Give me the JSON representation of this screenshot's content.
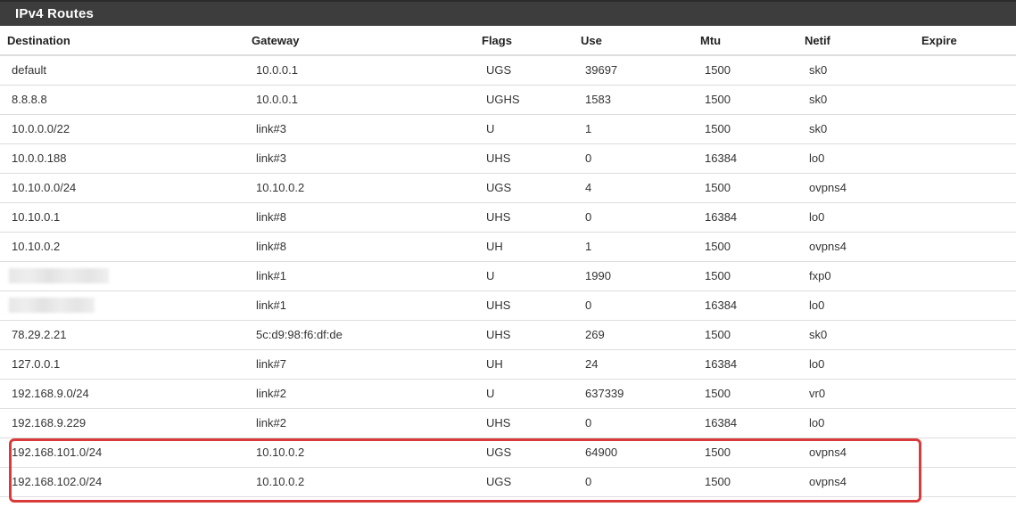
{
  "panel": {
    "title": "IPv4 Routes"
  },
  "table": {
    "headers": {
      "destination": "Destination",
      "gateway": "Gateway",
      "flags": "Flags",
      "use": "Use",
      "mtu": "Mtu",
      "netif": "Netif",
      "expire": "Expire"
    },
    "rows": [
      {
        "destination": "default",
        "gateway": "10.0.0.1",
        "flags": "UGS",
        "use": "39697",
        "mtu": "1500",
        "netif": "sk0",
        "expire": ""
      },
      {
        "destination": "8.8.8.8",
        "gateway": "10.0.0.1",
        "flags": "UGHS",
        "use": "1583",
        "mtu": "1500",
        "netif": "sk0",
        "expire": ""
      },
      {
        "destination": "10.0.0.0/22",
        "gateway": "link#3",
        "flags": "U",
        "use": "1",
        "mtu": "1500",
        "netif": "sk0",
        "expire": ""
      },
      {
        "destination": "10.0.0.188",
        "gateway": "link#3",
        "flags": "UHS",
        "use": "0",
        "mtu": "16384",
        "netif": "lo0",
        "expire": ""
      },
      {
        "destination": "10.10.0.0/24",
        "gateway": "10.10.0.2",
        "flags": "UGS",
        "use": "4",
        "mtu": "1500",
        "netif": "ovpns4",
        "expire": ""
      },
      {
        "destination": "10.10.0.1",
        "gateway": "link#8",
        "flags": "UHS",
        "use": "0",
        "mtu": "16384",
        "netif": "lo0",
        "expire": ""
      },
      {
        "destination": "10.10.0.2",
        "gateway": "link#8",
        "flags": "UH",
        "use": "1",
        "mtu": "1500",
        "netif": "ovpns4",
        "expire": ""
      },
      {
        "destination": "",
        "gateway": "link#1",
        "flags": "U",
        "use": "1990",
        "mtu": "1500",
        "netif": "fxp0",
        "expire": ""
      },
      {
        "destination": "",
        "gateway": "link#1",
        "flags": "UHS",
        "use": "0",
        "mtu": "16384",
        "netif": "lo0",
        "expire": ""
      },
      {
        "destination": "78.29.2.21",
        "gateway": "5c:d9:98:f6:df:de",
        "flags": "UHS",
        "use": "269",
        "mtu": "1500",
        "netif": "sk0",
        "expire": ""
      },
      {
        "destination": "127.0.0.1",
        "gateway": "link#7",
        "flags": "UH",
        "use": "24",
        "mtu": "16384",
        "netif": "lo0",
        "expire": ""
      },
      {
        "destination": "192.168.9.0/24",
        "gateway": "link#2",
        "flags": "U",
        "use": "637339",
        "mtu": "1500",
        "netif": "vr0",
        "expire": ""
      },
      {
        "destination": "192.168.9.229",
        "gateway": "link#2",
        "flags": "UHS",
        "use": "0",
        "mtu": "16384",
        "netif": "lo0",
        "expire": ""
      },
      {
        "destination": "192.168.101.0/24",
        "gateway": "10.10.0.2",
        "flags": "UGS",
        "use": "64900",
        "mtu": "1500",
        "netif": "ovpns4",
        "expire": ""
      },
      {
        "destination": "192.168.102.0/24",
        "gateway": "10.10.0.2",
        "flags": "UGS",
        "use": "0",
        "mtu": "1500",
        "netif": "ovpns4",
        "expire": ""
      }
    ]
  },
  "colors": {
    "header_bg": "#3d3d3d",
    "header_text": "#ffffff",
    "highlight_border": "#d93b3b",
    "row_border": "#dddddd"
  }
}
